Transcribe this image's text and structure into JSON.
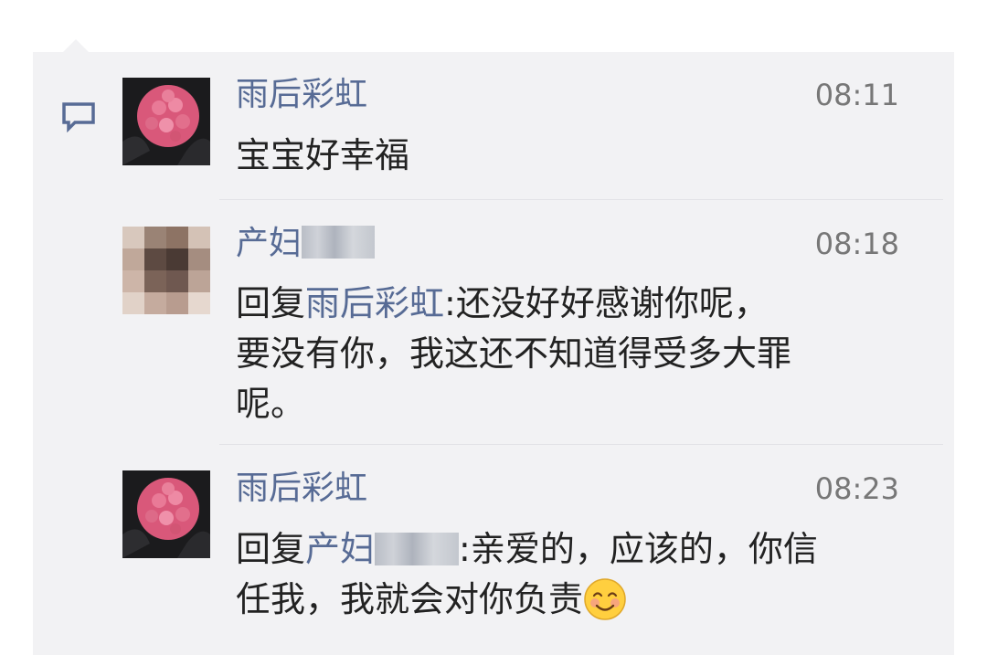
{
  "comments": [
    {
      "author": "雨后彩虹",
      "time": "08:11",
      "text": "宝宝好幸福",
      "avatar_icon": "pink-rose-bouquet-avatar"
    },
    {
      "author": "产妇",
      "time": "08:18",
      "reply_prefix": "回复",
      "reply_to": "雨后彩虹",
      "reply_sep": ":",
      "line1": "还没好好感谢你呢，",
      "line2": "要没有你，我这还不知道得受多大罪",
      "line3": "呢。",
      "avatar_icon": "blurred-avatar"
    },
    {
      "author": "雨后彩虹",
      "time": "08:23",
      "reply_prefix": "回复",
      "reply_to": "产妇",
      "reply_sep": ":",
      "line1": "亲爱的，应该的，你信",
      "line2": "任我，我就会对你负责",
      "emoji_icon": "smiling-face-emoji",
      "avatar_icon": "pink-rose-bouquet-avatar"
    }
  ],
  "colors": {
    "link": "#576b95",
    "panel": "#f2f2f4",
    "text": "#222222"
  }
}
